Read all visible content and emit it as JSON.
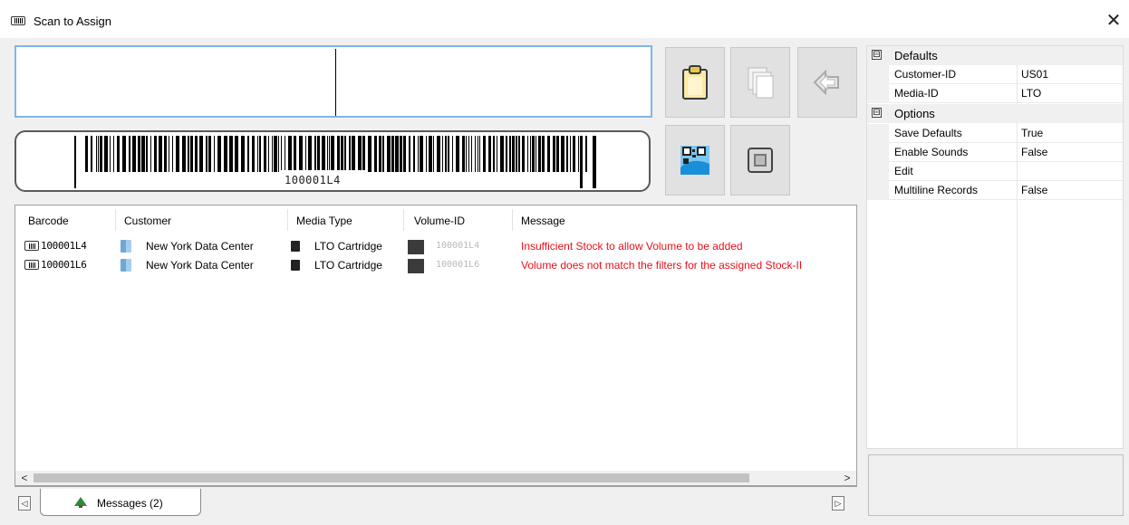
{
  "window": {
    "title": "Scan to Assign",
    "close_glyph": "✕"
  },
  "scan": {
    "input_value": "",
    "barcode_value": "100001L4"
  },
  "toolbar": [
    {
      "name": "paste-button",
      "icon": "clipboard-icon"
    },
    {
      "name": "copy-button",
      "icon": "copy-icon"
    },
    {
      "name": "back-button",
      "icon": "arrow-left-icon"
    },
    {
      "name": "qr-scan-button",
      "icon": "qr-code-icon"
    },
    {
      "name": "stop-button",
      "icon": "stop-square-icon"
    }
  ],
  "grid": {
    "columns": [
      "Barcode",
      "Customer",
      "Media Type",
      "Volume-ID",
      "Message"
    ],
    "rows": [
      {
        "barcode": "100001L4",
        "customer": "New York Data Center",
        "media": "LTO Cartridge",
        "volume": "100001L4",
        "message": "Insufficient Stock to allow Volume to be added"
      },
      {
        "barcode": "100001L6",
        "customer": "New York Data Center",
        "media": "LTO Cartridge",
        "volume": "100001L6",
        "message": "Volume does not match the filters for the assigned Stock-II"
      }
    ]
  },
  "tabs": [
    {
      "label": "Messages (2)"
    }
  ],
  "scroll": {
    "left": "<",
    "right": ">"
  },
  "tab_nav": {
    "prev": "◁",
    "next": "▷"
  },
  "properties": {
    "categories": [
      {
        "label": "Defaults",
        "expander": "⊟",
        "items": [
          {
            "name": "Customer-ID",
            "value": "US01"
          },
          {
            "name": "Media-ID",
            "value": "LTO"
          }
        ]
      },
      {
        "label": "Options",
        "expander": "⊟",
        "items": [
          {
            "name": "Save Defaults",
            "value": "True"
          },
          {
            "name": "Enable Sounds",
            "value": "False"
          },
          {
            "name": "Edit",
            "value": ""
          },
          {
            "name": "Multiline Records",
            "value": "False"
          }
        ]
      }
    ]
  },
  "colors": {
    "error": "#e8101c",
    "input_border": "#7fb6e6",
    "volume_text": "#b8b8b8"
  }
}
